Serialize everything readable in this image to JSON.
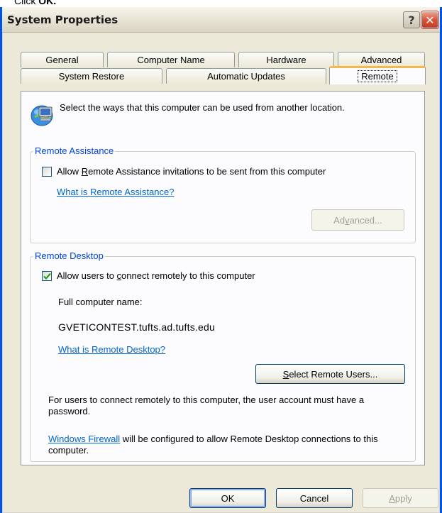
{
  "instruction": {
    "prefix": "Click ",
    "bold": "OK."
  },
  "window": {
    "title": "System Properties",
    "help_glyph": "?",
    "close_glyph": "✕"
  },
  "tabs": {
    "row1": [
      "General",
      "Computer Name",
      "Hardware",
      "Advanced"
    ],
    "row2": [
      "System Restore",
      "Automatic Updates",
      "Remote"
    ],
    "active": "Remote"
  },
  "intro": {
    "text": "Select the ways that this computer can be used from another location.",
    "icon": "computer-network-icon"
  },
  "remote_assistance": {
    "legend": "Remote Assistance",
    "checkbox_pre": "Allow ",
    "checkbox_mn": "R",
    "checkbox_post": "emote Assistance invitations to be sent from this computer",
    "checked": false,
    "link": "What is Remote Assistance?",
    "advanced_pre": "Ad",
    "advanced_mn": "v",
    "advanced_post": "anced...",
    "advanced_enabled": false
  },
  "remote_desktop": {
    "legend": "Remote Desktop",
    "checkbox_pre": "Allow users to ",
    "checkbox_mn": "c",
    "checkbox_post": "onnect remotely to this computer",
    "checked": true,
    "fullname_label": "Full computer name:",
    "fullname_value": "GVETICONTEST.tufts.ad.tufts.edu",
    "link": "What is Remote Desktop?",
    "select_users_mn": "S",
    "select_users_post": "elect Remote Users...",
    "password_note": "For users to connect remotely to this computer, the user account must have a password.",
    "firewall_link": "Windows Firewall",
    "firewall_rest": " will be configured to allow Remote Desktop connections to this computer."
  },
  "footer": {
    "ok": "OK",
    "cancel": "Cancel",
    "apply_mn": "A",
    "apply_post": "pply",
    "apply_enabled": false
  },
  "colors": {
    "accent_blue": "#0046d5",
    "link_blue": "#0066cc",
    "tab_highlight": "#f7b84b",
    "window_bg": "#ece9d8"
  }
}
